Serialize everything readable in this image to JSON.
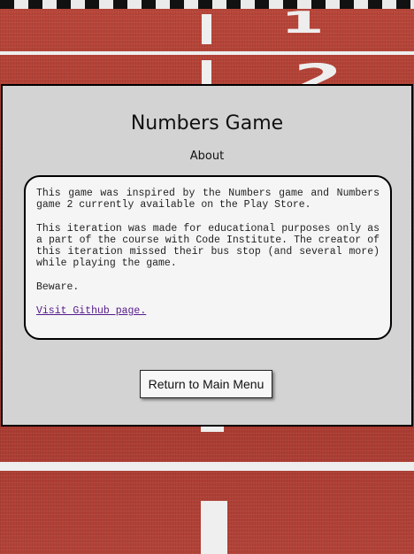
{
  "header": {
    "title": "Numbers Game",
    "subtitle": "About"
  },
  "about": {
    "paragraph_1": "This game was inspired by the Numbers game and Numbers game 2 currently available on the Play Store.",
    "paragraph_2": "This iteration was made for educational purposes only as a part of the course with Code Institute. The creator of this iteration missed their bus stop (and several more) while playing the game.",
    "paragraph_3": "Beware.",
    "link_text": "Visit Github page."
  },
  "actions": {
    "return_label": "Return to Main Menu"
  },
  "background": {
    "lane_number_top": "1",
    "lane_number_second": "2"
  },
  "colors": {
    "panel": "#d3d3d3",
    "card": "#f5f5f5",
    "track": "#a83a30",
    "link": "#551a8b"
  }
}
